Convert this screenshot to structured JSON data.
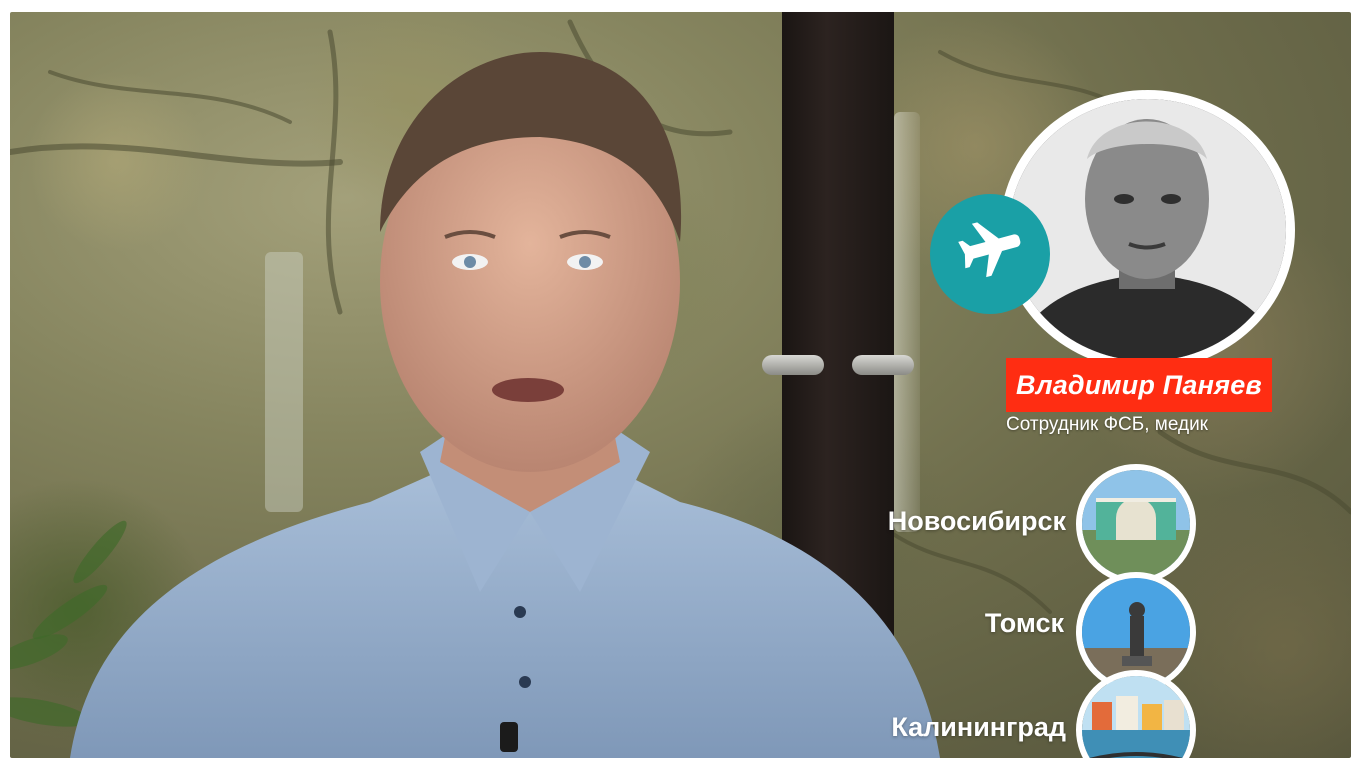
{
  "person": {
    "name": "Владимир Паняев",
    "role": "Сотрудник ФСБ, медик"
  },
  "cities": [
    {
      "label": "Новосибирск"
    },
    {
      "label": "Томск"
    },
    {
      "label": "Калининград"
    }
  ],
  "colors": {
    "name_tag_bg": "#ff2d12",
    "plane_badge_bg": "#1aa0a6",
    "text": "#ffffff"
  },
  "icons": {
    "plane": "airplane-icon"
  }
}
